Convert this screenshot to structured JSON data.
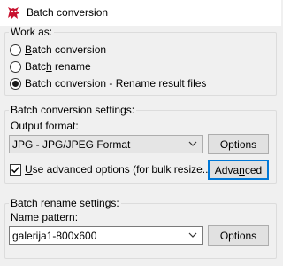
{
  "window": {
    "title": "Batch conversion"
  },
  "work_as": {
    "group_label": "Work as:",
    "options": [
      {
        "before": "",
        "accel": "B",
        "after": "atch conversion",
        "checked": false
      },
      {
        "before": "Batc",
        "accel": "h",
        "after": " rename",
        "checked": false
      },
      {
        "before": "Batch conversion - Rename result files",
        "accel": "",
        "after": "",
        "checked": true
      }
    ]
  },
  "conversion_settings": {
    "group_label": "Batch conversion settings:",
    "output_format_label": "Output format:",
    "output_format_value": "JPG - JPG/JPEG Format",
    "options_button": "Options",
    "advanced_checkbox": {
      "accel": "U",
      "after": "se advanced options (for bulk resize...)",
      "checked": true
    },
    "advanced_button": {
      "before": "Adva",
      "accel": "n",
      "after": "ced"
    }
  },
  "rename_settings": {
    "group_label": "Batch rename settings:",
    "name_pattern_label": "Name pattern:",
    "name_pattern_value": "galerija1-800x600",
    "options_button": "Options"
  },
  "colors": {
    "focus": "#0078d7",
    "background": "#f0f0f0"
  },
  "icons": {
    "app": "irfanview-cat-icon",
    "dropdown": "chevron-down-icon",
    "check": "check-icon"
  }
}
